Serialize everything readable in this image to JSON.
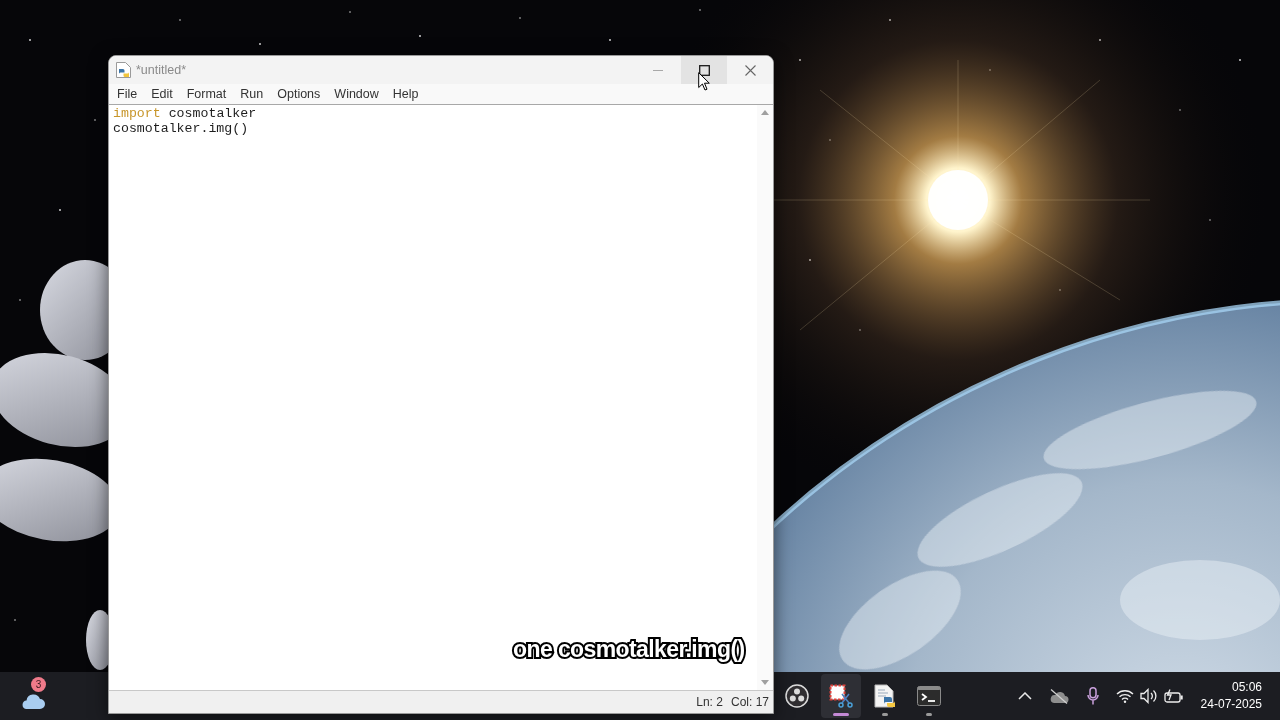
{
  "window": {
    "title": "*untitled*",
    "controls": [
      {
        "kind": "minimize",
        "hovered": false
      },
      {
        "kind": "maximize",
        "hovered": true
      },
      {
        "kind": "close",
        "hovered": false
      }
    ]
  },
  "menu": [
    "File",
    "Edit",
    "Format",
    "Run",
    "Options",
    "Window",
    "Help"
  ],
  "editor": {
    "lines": [
      [
        {
          "kind": "keyword",
          "text": "import"
        },
        {
          "kind": "plain",
          "text": "cosmotalker"
        }
      ],
      [
        {
          "kind": "plain",
          "text": "cosmotalker.img()"
        }
      ]
    ]
  },
  "status_bar": {
    "line": "Ln: 2",
    "column": "Col: 17"
  },
  "caption": "one cosmotalker.img()",
  "taskbar": {
    "weather": {
      "badge": "3"
    },
    "apps": [
      {
        "kind": "obs",
        "active": false,
        "running": false
      },
      {
        "kind": "snipping",
        "active": true,
        "running": true
      },
      {
        "kind": "python_file",
        "active": false,
        "running": true
      },
      {
        "kind": "terminal",
        "active": false,
        "running": true
      }
    ],
    "tray": [
      {
        "kind": "chevron"
      },
      {
        "kind": "cloud_off"
      },
      {
        "kind": "microphone"
      },
      {
        "kind": "wifi"
      },
      {
        "kind": "volume"
      },
      {
        "kind": "battery"
      }
    ],
    "clock": {
      "time": "05:06",
      "date": "24-07-2025"
    }
  }
}
